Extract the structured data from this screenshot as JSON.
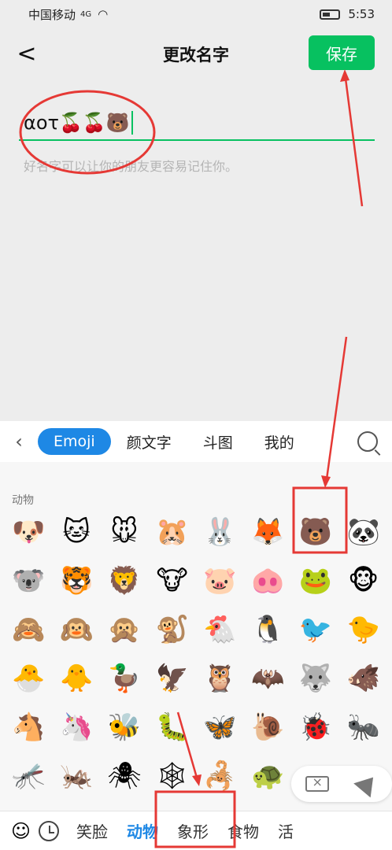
{
  "status": {
    "carrier": "中国移动",
    "network": "4G",
    "time": "5:53"
  },
  "header": {
    "title": "更改名字",
    "save_label": "保存",
    "back_icon": "<"
  },
  "name_field": {
    "value": "αoτ🍒🍒🐻",
    "hint": "好名字可以让你的朋友更容易记住你。"
  },
  "keyboard": {
    "tabs": [
      "Emoji",
      "颜文字",
      "斗图",
      "我的"
    ],
    "category": "动物",
    "rows": [
      [
        "🐶",
        "🐱",
        "🐭",
        "🐹",
        "🐰",
        "🦊",
        "🐻",
        "🐼"
      ],
      [
        "🐨",
        "🐯",
        "🦁",
        "🐮",
        "🐷",
        "🐽",
        "🐸",
        "🐵"
      ],
      [
        "🙈",
        "🙉",
        "🙊",
        "🐒",
        "🐔",
        "🐧",
        "🐦",
        "🐤"
      ],
      [
        "🐣",
        "🐥",
        "🦆",
        "🦅",
        "🦉",
        "🦇",
        "🐺",
        "🐗"
      ],
      [
        "🐴",
        "🦄",
        "🐝",
        "🐛",
        "🦋",
        "🐌",
        "🐞",
        "🐜"
      ],
      [
        "🦟",
        "🦗",
        "🕷",
        "🕸",
        "🦂",
        "🐢",
        "",
        ""
      ]
    ],
    "bottom_tabs": [
      "笑脸",
      "动物",
      "象形",
      "食物",
      "活"
    ]
  },
  "colors": {
    "accent": "#07c160",
    "keyboard_blue": "#1e88e5",
    "annotation": "#e53935"
  }
}
